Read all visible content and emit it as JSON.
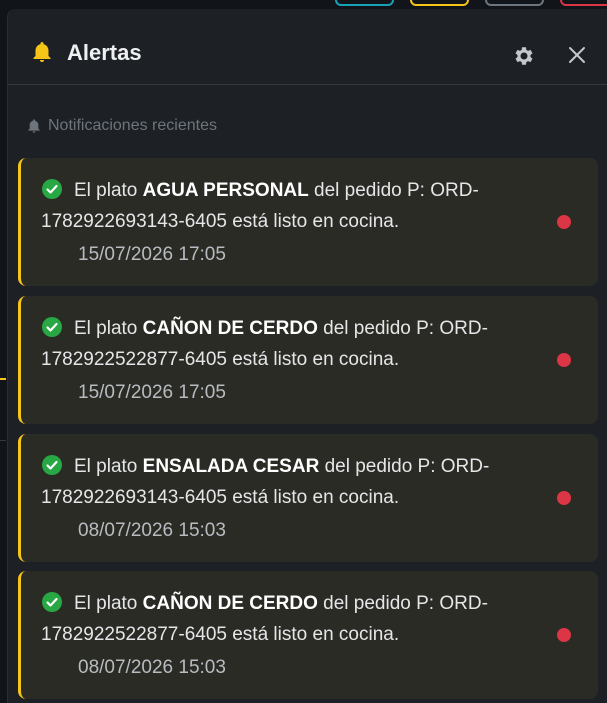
{
  "header": {
    "title": "Alertas",
    "bell_icon": "bell-icon",
    "settings_icon": "gear-icon",
    "close_icon": "close-icon",
    "accent_color": "#f5c518"
  },
  "section": {
    "label": "Notificaciones recientes"
  },
  "notifications": [
    {
      "prefix": "El plato ",
      "dish": "AGUA PERSONAL",
      "suffix": " del pedido P: ORD-1782922693143-6405 está listo en cocina.",
      "time": "15/07/2026 17:05",
      "unread": true
    },
    {
      "prefix": "El plato ",
      "dish": "CAÑON DE CERDO",
      "suffix": " del pedido P: ORD-1782922522877-6405 está listo en cocina.",
      "time": "15/07/2026 17:05",
      "unread": true
    },
    {
      "prefix": "El plato ",
      "dish": "ENSALADA CESAR",
      "suffix": " del pedido P: ORD-1782922693143-6405 está listo en cocina.",
      "time": "08/07/2026 15:03",
      "unread": true
    },
    {
      "prefix": "El plato ",
      "dish": "CAÑON DE CERDO",
      "suffix": " del pedido P: ORD-1782922522877-6405 está listo en cocina.",
      "time": "08/07/2026 15:03",
      "unread": true
    }
  ],
  "colors": {
    "card_border": "#f5c518",
    "success": "#28a745",
    "unread_dot": "#dc3545"
  }
}
